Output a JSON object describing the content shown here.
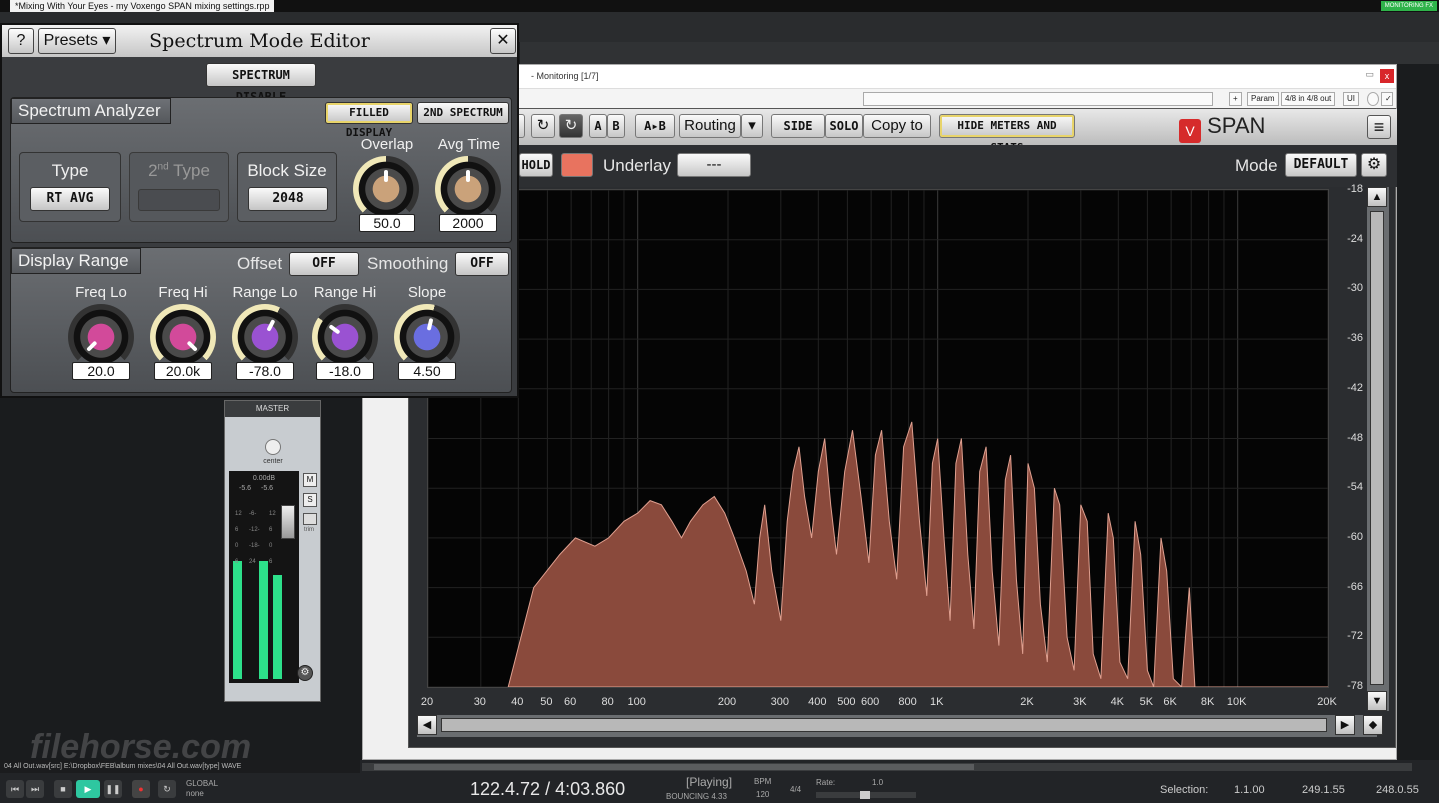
{
  "window": {
    "title": "*Mixing With Your Eyes - my Voxengo SPAN mixing settings.rpp",
    "badge": "MONITORING FX"
  },
  "host": {
    "title": "- Monitoring [1/7]",
    "param_label": "Param",
    "io_label": "4/8 in 4/8 out",
    "ui_label": "UI",
    "close": "x"
  },
  "toolbar": {
    "a": "A",
    "b": "B",
    "atob": "A▸B",
    "routing": "Routing",
    "side": "SIDE",
    "solo": "SOLO",
    "copy_to": "Copy to",
    "hide_meters": "HIDE METERS AND STATS",
    "logo_text": "SPAN",
    "logo_mark": "V",
    "menu_icon": "≡"
  },
  "controls": {
    "hold": "HOLD",
    "underlay_label": "Underlay",
    "underlay_value": "---",
    "mode_label": "Mode",
    "mode_value": "DEFAULT"
  },
  "graph": {
    "x_ticks": [
      "20",
      "30",
      "40",
      "50",
      "60",
      "80",
      "100",
      "200",
      "300",
      "400",
      "500",
      "600",
      "800",
      "1K",
      "2K",
      "3K",
      "4K",
      "5K",
      "6K",
      "8K",
      "10K",
      "20K"
    ],
    "x_values": [
      20,
      30,
      40,
      50,
      60,
      80,
      100,
      200,
      300,
      400,
      500,
      600,
      800,
      1000,
      2000,
      3000,
      4000,
      5000,
      6000,
      8000,
      10000,
      20000
    ],
    "y_ticks": [
      "-18",
      "-24",
      "-30",
      "-36",
      "-42",
      "-48",
      "-54",
      "-60",
      "-66",
      "-72",
      "-78"
    ],
    "y_values": [
      -18,
      -24,
      -30,
      -36,
      -42,
      -48,
      -54,
      -60,
      -66,
      -72,
      -78
    ],
    "ylim": [
      -78,
      -18
    ],
    "xlim": [
      20,
      20000
    ],
    "fill_color": "#8a4a3c",
    "line_color": "#e0a090",
    "spectrum": [
      [
        37,
        -78
      ],
      [
        45,
        -66
      ],
      [
        55,
        -62
      ],
      [
        62,
        -60
      ],
      [
        72,
        -61
      ],
      [
        80,
        -60
      ],
      [
        90,
        -58
      ],
      [
        100,
        -57
      ],
      [
        110,
        -55.5
      ],
      [
        120,
        -56
      ],
      [
        130,
        -58
      ],
      [
        140,
        -60
      ],
      [
        150,
        -58
      ],
      [
        165,
        -56
      ],
      [
        180,
        -55
      ],
      [
        195,
        -57
      ],
      [
        210,
        -60
      ],
      [
        230,
        -64
      ],
      [
        245,
        -68
      ],
      [
        255,
        -60
      ],
      [
        265,
        -56
      ],
      [
        280,
        -64
      ],
      [
        300,
        -70
      ],
      [
        315,
        -58
      ],
      [
        330,
        -52
      ],
      [
        345,
        -49
      ],
      [
        360,
        -55
      ],
      [
        380,
        -60
      ],
      [
        400,
        -52
      ],
      [
        420,
        -48
      ],
      [
        440,
        -56
      ],
      [
        460,
        -62
      ],
      [
        490,
        -52
      ],
      [
        520,
        -47
      ],
      [
        555,
        -55
      ],
      [
        590,
        -63
      ],
      [
        620,
        -50
      ],
      [
        650,
        -47
      ],
      [
        690,
        -58
      ],
      [
        730,
        -65
      ],
      [
        770,
        -49
      ],
      [
        820,
        -46
      ],
      [
        870,
        -58
      ],
      [
        920,
        -67
      ],
      [
        960,
        -51
      ],
      [
        1000,
        -48
      ],
      [
        1050,
        -60
      ],
      [
        1100,
        -70
      ],
      [
        1150,
        -51
      ],
      [
        1200,
        -48
      ],
      [
        1260,
        -62
      ],
      [
        1320,
        -71
      ],
      [
        1380,
        -52
      ],
      [
        1450,
        -49
      ],
      [
        1520,
        -64
      ],
      [
        1600,
        -73
      ],
      [
        1680,
        -53
      ],
      [
        1750,
        -50
      ],
      [
        1830,
        -65
      ],
      [
        1920,
        -74
      ],
      [
        2000,
        -51
      ],
      [
        2100,
        -54
      ],
      [
        2200,
        -68
      ],
      [
        2320,
        -75
      ],
      [
        2450,
        -54
      ],
      [
        2550,
        -56
      ],
      [
        2700,
        -72
      ],
      [
        2850,
        -76
      ],
      [
        3000,
        -56
      ],
      [
        3150,
        -58
      ],
      [
        3300,
        -74
      ],
      [
        3500,
        -77
      ],
      [
        3700,
        -57
      ],
      [
        3850,
        -60
      ],
      [
        4050,
        -75
      ],
      [
        4300,
        -77
      ],
      [
        4550,
        -58
      ],
      [
        4750,
        -62
      ],
      [
        5000,
        -76
      ],
      [
        5250,
        -78
      ],
      [
        5550,
        -60
      ],
      [
        5800,
        -64
      ],
      [
        6100,
        -77
      ],
      [
        6500,
        -78
      ],
      [
        6900,
        -66
      ],
      [
        7200,
        -78
      ],
      [
        20000,
        -78
      ]
    ]
  },
  "editor": {
    "help": "?",
    "presets": "Presets",
    "title": "Spectrum Mode Editor",
    "close": "✕",
    "spectrum_disable": "SPECTRUM DISABLE",
    "analyzer_title": "Spectrum Analyzer",
    "filled_display": "FILLED DISPLAY",
    "second_spectrum": "2ND SPECTRUM",
    "type_label": "Type",
    "type_value": "RT AVG",
    "type2_label_pre": "2",
    "type2_label_sup": "nd",
    "type2_label_post": " Type",
    "block_size_label": "Block Size",
    "block_size_value": "2048",
    "overlap_label": "Overlap",
    "overlap_value": "50.0",
    "overlap_level": 0.5,
    "avg_time_label": "Avg Time",
    "avg_time_value": "2000",
    "avg_time_level": 0.5,
    "range_title": "Display Range",
    "offset_label": "Offset",
    "offset_value": "OFF",
    "smoothing_label": "Smoothing",
    "smoothing_value": "OFF",
    "knobs": [
      {
        "label": "Freq Lo",
        "value": "20.0",
        "color": "#d24a9a",
        "level": 0.0
      },
      {
        "label": "Freq Hi",
        "value": "20.0k",
        "color": "#d24a9a",
        "level": 1.0
      },
      {
        "label": "Range Lo",
        "value": "-78.0",
        "color": "#9a52d2",
        "level": 0.6
      },
      {
        "label": "Range Hi",
        "value": "-18.0",
        "color": "#9a52d2",
        "level": 0.3
      },
      {
        "label": "Slope",
        "value": "4.50",
        "color": "#6a6ee0",
        "level": 0.55
      }
    ]
  },
  "mixer": {
    "title": "MASTER",
    "pan_label": "center",
    "peak": "0.00dB",
    "left_peak": "-5.6",
    "right_peak": "-5.6",
    "mute": "M",
    "solo": "S",
    "trim": "trim",
    "fader_marks": [
      "12",
      "-6-",
      "12",
      "6",
      "-12-",
      "6",
      "0",
      "-18-",
      "0",
      "6",
      "24",
      "6"
    ],
    "levels": [
      0.62,
      0.62,
      0.55
    ]
  },
  "transport": {
    "track_info": "04 All Out.wav[src] E:\\Dropbox\\FEB\\album mixes\\04 All Out.wav[type] WAVE",
    "global_label": "GLOBAL",
    "global_mode": "none",
    "time": "122.4.72 / 4:03.860",
    "playing": "[Playing]",
    "bouncing": "BOUNCING 4.33",
    "bpm_label": "BPM",
    "bpm": "120",
    "sig": "4/4",
    "rate_label": "Rate:",
    "rate": "1.0",
    "selection_label": "Selection:",
    "sel_start": "1.1.00",
    "sel_end": "249.1.55",
    "sel_len": "248.0.55"
  },
  "watermark": "filehorse.com"
}
